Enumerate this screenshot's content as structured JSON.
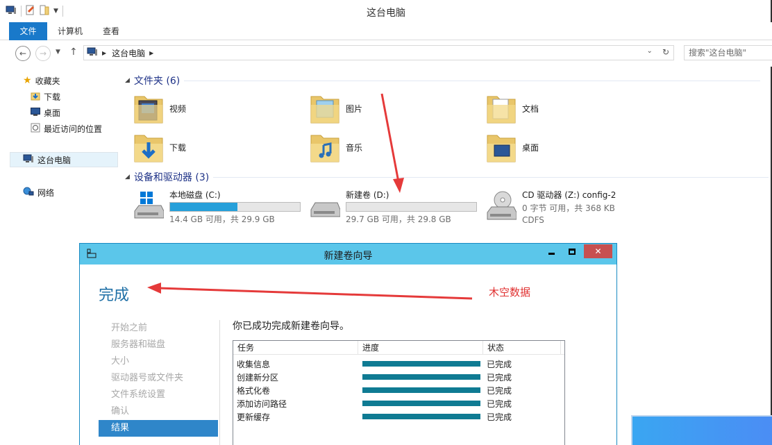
{
  "explorer": {
    "title": "这台电脑",
    "tabs": [
      "文件",
      "计算机",
      "查看"
    ],
    "address": {
      "crumb": "这台电脑"
    },
    "search": {
      "placeholder": "搜索\"这台电脑\""
    },
    "nav": {
      "favorites": "收藏夹",
      "downloads": "下载",
      "desktop": "桌面",
      "recent": "最近访问的位置",
      "this_pc": "这台电脑",
      "network": "网络"
    },
    "folders": {
      "header": "文件夹 (6)",
      "items": [
        "视频",
        "图片",
        "文档",
        "下载",
        "音乐",
        "桌面"
      ]
    },
    "devices": {
      "header": "设备和驱动器 (3)",
      "items": [
        {
          "name": "本地磁盘 (C:)",
          "detail": "14.4 GB 可用，共 29.9 GB",
          "used_fraction": 0.52
        },
        {
          "name": "新建卷 (D:)",
          "detail": "29.7 GB 可用，共 29.8 GB",
          "used_fraction": 0.0
        },
        {
          "name": "CD 驱动器 (Z:) config-2",
          "detail": "0 字节 可用，共 368 KB",
          "fs": "CDFS"
        }
      ]
    }
  },
  "wizard": {
    "title": "新建卷向导",
    "heading": "完成",
    "annotation": "木空数据",
    "steps": [
      "开始之前",
      "服务器和磁盘",
      "大小",
      "驱动器号或文件夹",
      "文件系统设置",
      "确认",
      "结果"
    ],
    "current_step": "结果",
    "message": "你已成功完成新建卷向导。",
    "table": {
      "headers": [
        "任务",
        "进度",
        "状态"
      ],
      "rows": [
        {
          "task": "收集信息",
          "status": "已完成",
          "progress": 1.0
        },
        {
          "task": "创建新分区",
          "status": "已完成",
          "progress": 1.0
        },
        {
          "task": "格式化卷",
          "status": "已完成",
          "progress": 1.0
        },
        {
          "task": "添加访问路径",
          "status": "已完成",
          "progress": 1.0
        },
        {
          "task": "更新缓存",
          "status": "已完成",
          "progress": 1.0
        }
      ]
    }
  },
  "colors": {
    "accent": "#1979ca",
    "drive_bar": "#26a0da",
    "progress_bar": "#0f7b93",
    "annotation": "#e03030",
    "wizard_title": "#5bc6ea"
  }
}
